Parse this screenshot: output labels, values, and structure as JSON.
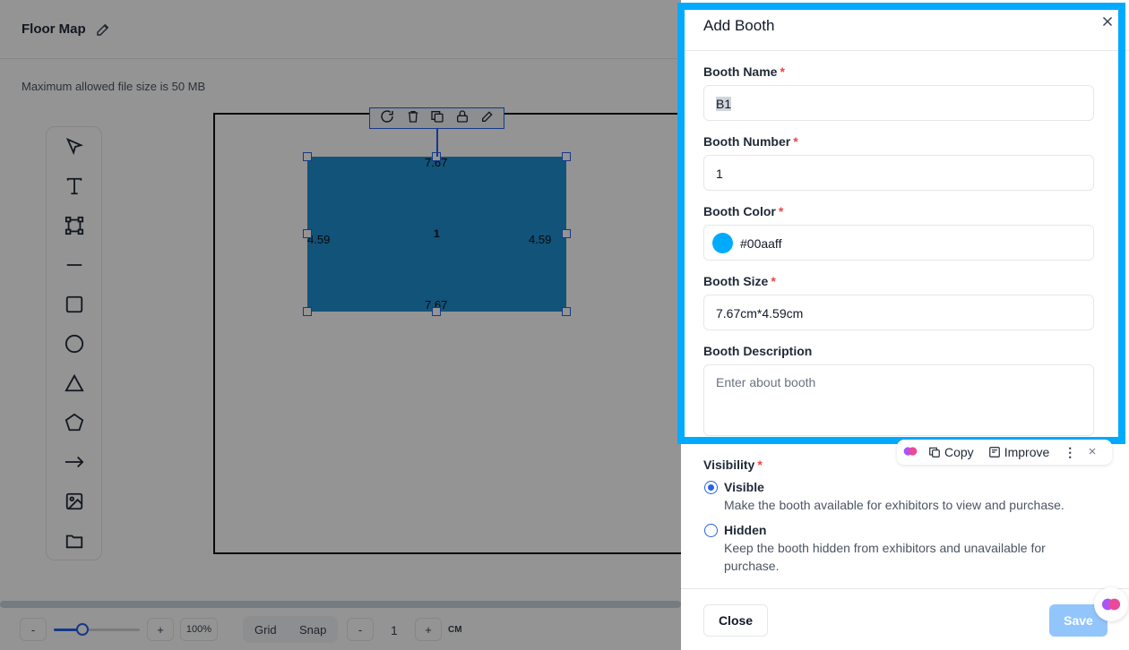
{
  "page": {
    "title": "Floor Map",
    "file_size_note": "Maximum allowed file size is 50 MB"
  },
  "toolbar": {
    "tools": [
      "select-arrow-icon",
      "text-icon",
      "frame-icon",
      "line-icon",
      "square-icon",
      "circle-icon",
      "triangle-icon",
      "pentagon-icon",
      "arrow-icon",
      "image-icon",
      "folder-icon"
    ]
  },
  "canvas": {
    "booth": {
      "number_label": "1",
      "width_label": "7.67",
      "height_label": "4.59",
      "color": "#1e8fd0"
    }
  },
  "bottom_bar": {
    "zoom_minus": "-",
    "zoom_plus": "+",
    "zoom_value": "100%",
    "zoom_level": 0.33,
    "grid_label": "Grid",
    "snap_label": "Snap",
    "scale_minus": "-",
    "scale_value": "1",
    "scale_plus": "+",
    "unit": "CM"
  },
  "drawer": {
    "title": "Add Booth",
    "fields": {
      "booth_name": {
        "label": "Booth Name",
        "value": "B1"
      },
      "booth_number": {
        "label": "Booth Number",
        "value": "1"
      },
      "booth_color": {
        "label": "Booth Color",
        "value": "#00aaff"
      },
      "booth_size": {
        "label": "Booth Size",
        "value": "7.67cm*4.59cm"
      },
      "booth_description": {
        "label": "Booth Description",
        "placeholder": "Enter about booth"
      }
    },
    "visibility": {
      "label": "Visibility",
      "options": [
        {
          "label": "Visible",
          "description": "Make the booth available for exhibitors to view and purchase.",
          "selected": true
        },
        {
          "label": "Hidden",
          "description": "Keep the booth hidden from exhibitors and unavailable for purchase.",
          "selected": false
        }
      ]
    },
    "buttons": {
      "close": "Close",
      "save": "Save"
    }
  },
  "ai_toolbar": {
    "copy": "Copy",
    "improve": "Improve"
  },
  "colors": {
    "accent": "#2563eb",
    "highlight": "#00aaff",
    "required": "#ef4444"
  }
}
